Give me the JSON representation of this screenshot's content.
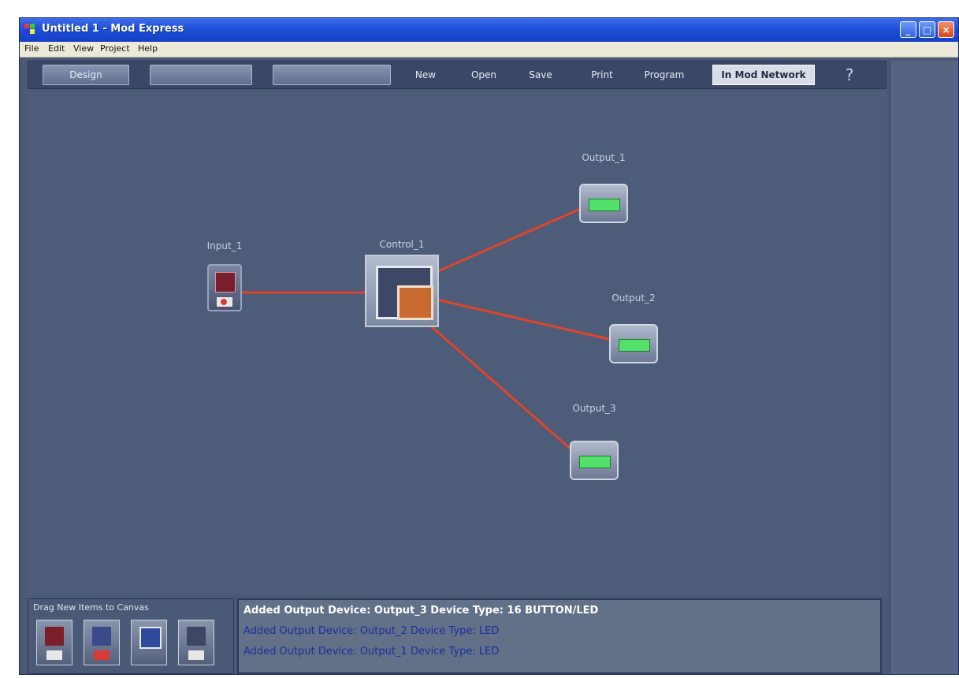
{
  "window": {
    "title": "Untitled 1 - Mod Express",
    "controls": {
      "minimize": "_",
      "maximize": "□",
      "close": "×"
    }
  },
  "menu": [
    "File",
    "Edit",
    "View",
    "Project",
    "Help"
  ],
  "toolbar": {
    "design": "Design",
    "field1": "",
    "field2": "",
    "buttons": [
      "New",
      "Open",
      "Save",
      "Print",
      "Program"
    ],
    "highlight": "In Mod Network",
    "help": "?"
  },
  "canvas": {
    "nodes": [
      {
        "id": "input1",
        "label": "Input_1",
        "kind": "input"
      },
      {
        "id": "ctrl1",
        "label": "Control_1",
        "kind": "controller"
      },
      {
        "id": "out1",
        "label": "Output_1",
        "kind": "output"
      },
      {
        "id": "out2",
        "label": "Output_2",
        "kind": "output"
      },
      {
        "id": "out3",
        "label": "Output_3",
        "kind": "output"
      }
    ],
    "link_color": "#e0452a"
  },
  "palette": {
    "title": "Drag New Items to Canvas"
  },
  "log": [
    "Added Output Device: Output_3 Device Type: 16 BUTTON/LED",
    "Added Output Device: Output_2 Device Type: LED",
    "Added Output Device: Output_1 Device Type: LED"
  ],
  "colors": {
    "titlebar": "#1e4fd8",
    "canvas": "#4d5c79",
    "led": "#53e06b"
  }
}
